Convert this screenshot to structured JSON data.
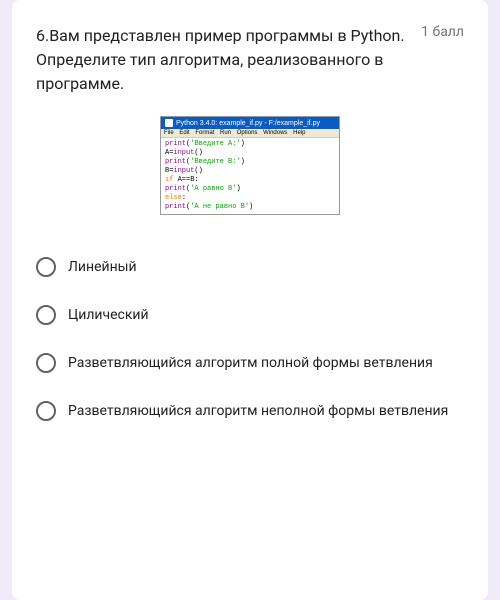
{
  "question": {
    "text": "6.Вам представлен пример программы в Python. Определите тип алгоритма, реализованного в программе.",
    "points": "1 балл"
  },
  "code_image": {
    "window_title": "Python 3.4.0: example_if.py - F:/example_if.py",
    "menu": [
      "File",
      "Edit",
      "Format",
      "Run",
      "Options",
      "Windows",
      "Help"
    ],
    "lines": [
      {
        "plain": "",
        "parts": [
          {
            "t": "builtin",
            "v": "print"
          },
          {
            "t": "",
            "v": "("
          },
          {
            "t": "str",
            "v": "'Введите A:'"
          },
          {
            "t": "",
            "v": ")"
          }
        ]
      },
      {
        "plain": "",
        "parts": [
          {
            "t": "",
            "v": "A="
          },
          {
            "t": "builtin",
            "v": "input"
          },
          {
            "t": "",
            "v": "()"
          }
        ]
      },
      {
        "plain": "",
        "parts": [
          {
            "t": "builtin",
            "v": "print"
          },
          {
            "t": "",
            "v": "("
          },
          {
            "t": "str",
            "v": "'Введите B:'"
          },
          {
            "t": "",
            "v": ")"
          }
        ]
      },
      {
        "plain": "",
        "parts": [
          {
            "t": "",
            "v": "B="
          },
          {
            "t": "builtin",
            "v": "input"
          },
          {
            "t": "",
            "v": "()"
          }
        ]
      },
      {
        "plain": "",
        "parts": [
          {
            "t": "kw",
            "v": "if"
          },
          {
            "t": "",
            "v": " A==B:"
          }
        ]
      },
      {
        "plain": "",
        "parts": [
          {
            "t": "",
            "v": "    "
          },
          {
            "t": "builtin",
            "v": "print"
          },
          {
            "t": "",
            "v": "("
          },
          {
            "t": "str",
            "v": "'A равно B'"
          },
          {
            "t": "",
            "v": ")"
          }
        ]
      },
      {
        "plain": "",
        "parts": [
          {
            "t": "kw",
            "v": "else"
          },
          {
            "t": "",
            "v": ":"
          }
        ]
      },
      {
        "plain": "",
        "parts": [
          {
            "t": "",
            "v": "    "
          },
          {
            "t": "builtin",
            "v": "print"
          },
          {
            "t": "",
            "v": "("
          },
          {
            "t": "str",
            "v": "'A не равно B'"
          },
          {
            "t": "",
            "v": ")"
          }
        ]
      }
    ]
  },
  "options": [
    {
      "label": "Линейный"
    },
    {
      "label": "Цилический"
    },
    {
      "label": "Разветвляющийся алгоритм полной формы ветвления"
    },
    {
      "label": "Разветвляющийся алгоритм неполной формы ветвления"
    }
  ]
}
